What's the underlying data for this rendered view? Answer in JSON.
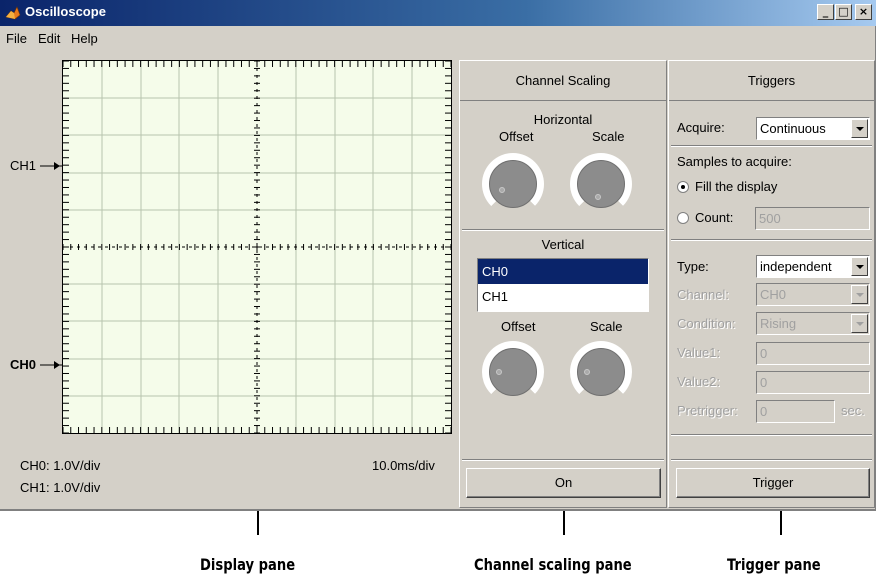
{
  "window": {
    "title": "Oscilloscope",
    "buttons": {
      "minimize": "_",
      "maximize": "□",
      "close": "×"
    }
  },
  "menu": [
    "File",
    "Edit",
    "Help"
  ],
  "display": {
    "ch1_marker": "CH1",
    "ch0_marker": "CH0",
    "ch0_scale": "CH0: 1.0V/div",
    "ch1_scale": "CH1: 1.0V/div",
    "time_scale": "10.0ms/div"
  },
  "channel_scaling": {
    "header": "Channel Scaling",
    "horizontal_title": "Horizontal",
    "offset_label": "Offset",
    "scale_label": "Scale",
    "vertical_title": "Vertical",
    "channels": [
      "CH0",
      "CH1"
    ],
    "selected_channel": "CH0",
    "v_offset_label": "Offset",
    "v_scale_label": "Scale",
    "on_button": "On"
  },
  "triggers": {
    "header": "Triggers",
    "acquire_label": "Acquire:",
    "acquire_value": "Continuous",
    "samples_label": "Samples to acquire:",
    "fill_label": "Fill the display",
    "count_label": "Count:",
    "count_value": "500",
    "type_label": "Type:",
    "type_value": "independent",
    "channel_label": "Channel:",
    "channel_value": "CH0",
    "condition_label": "Condition:",
    "condition_value": "Rising",
    "value1_label": "Value1:",
    "value1_value": "0",
    "value2_label": "Value2:",
    "value2_value": "0",
    "pretrigger_label": "Pretrigger:",
    "pretrigger_value": "0",
    "sec_label": "sec.",
    "trigger_button": "Trigger"
  },
  "callouts": {
    "display": "Display pane",
    "channel": "Channel scaling pane",
    "trigger": "Trigger pane"
  },
  "colors": {
    "title_bar": "#0a246a",
    "scope_bg": "#f5fcea",
    "selection": "#0a246a",
    "window_bg": "#d4d0c8"
  }
}
